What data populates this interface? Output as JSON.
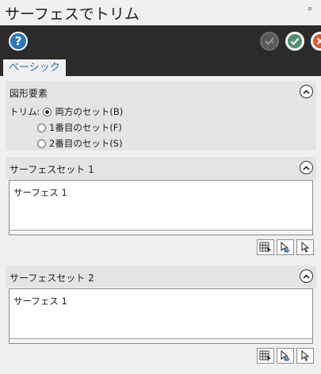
{
  "window": {
    "title": "サーフェスでトリム",
    "pin_glyph": "ᵖ"
  },
  "toolbar": {
    "help_label": "?",
    "icons": [
      "help-icon",
      "apply-icon",
      "ok-check-icon",
      "cancel-icon"
    ],
    "colors": {
      "help": "#2c77b8",
      "ok": "#4d8f72",
      "cancel": "#e5572b",
      "bar": "#2b2b2b"
    }
  },
  "tabs": [
    {
      "label": "ベーシック",
      "active": true
    }
  ],
  "shape_section": {
    "title": "図形要素",
    "trim_label": "トリム:",
    "options": [
      {
        "label": "両方のセット(B)",
        "selected": true
      },
      {
        "label": "1番目のセット(F)",
        "selected": false
      },
      {
        "label": "2番目のセット(S)",
        "selected": false
      }
    ]
  },
  "surface_set_1": {
    "title": "サーフェスセット 1",
    "items": [
      "サーフェス 1"
    ]
  },
  "surface_set_2": {
    "title": "サーフェスセット 2",
    "items": [
      "サーフェス 1"
    ]
  },
  "set_buttons": [
    "select-list-icon",
    "add-select-icon",
    "pointer-icon"
  ]
}
